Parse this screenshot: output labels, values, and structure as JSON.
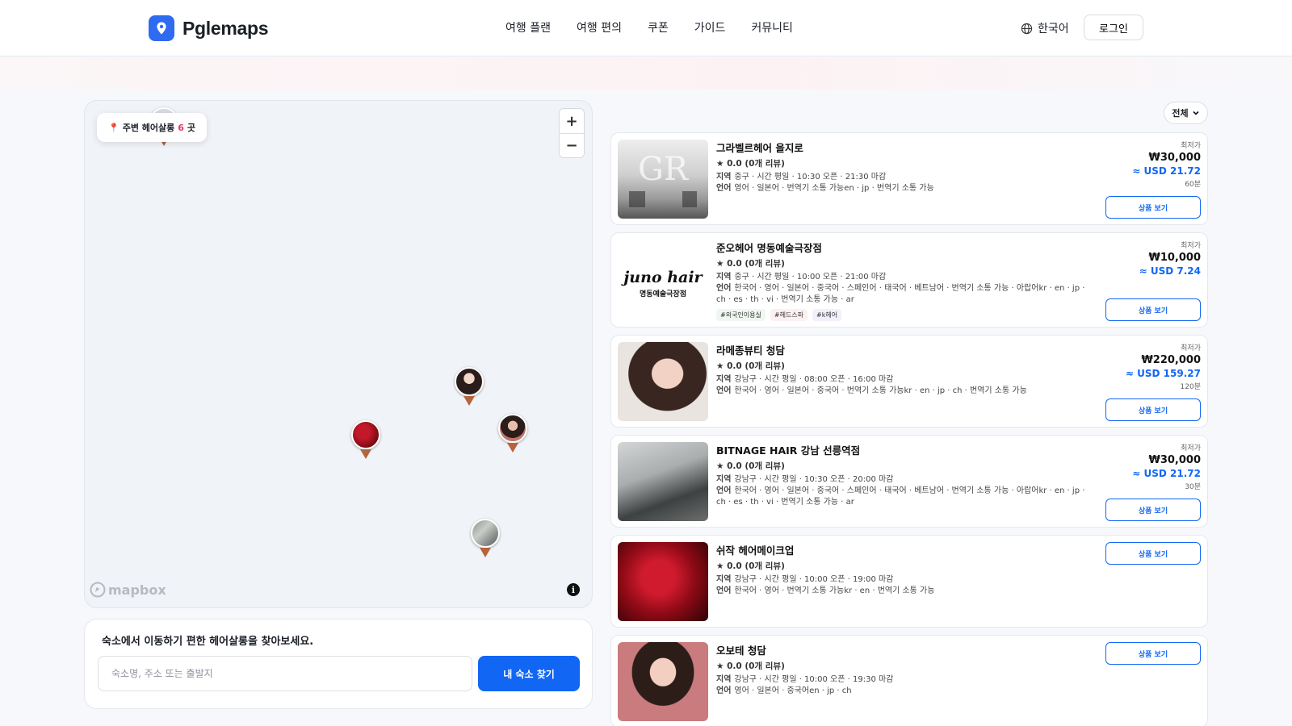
{
  "header": {
    "brand": "Pglemaps",
    "nav": [
      "여행 플랜",
      "여행 편의",
      "쿠폰",
      "가이드",
      "커뮤니티"
    ],
    "language": "한국어",
    "login": "로그인"
  },
  "map": {
    "badge_prefix": "주변 헤어살롱",
    "badge_count": "6",
    "badge_suffix": "곳",
    "zoom_in": "+",
    "zoom_out": "−",
    "attribution": "mapbox",
    "info": "i"
  },
  "search": {
    "title": "숙소에서 이동하기 편한 헤어살롱을 찾아보세요.",
    "placeholder": "숙소명, 주소 또는 출발지",
    "button": "내 숙소 찾기"
  },
  "filter": {
    "label": "전체"
  },
  "labels": {
    "region": "지역",
    "language": "언어",
    "lowest": "최저가",
    "view": "상품 보기"
  },
  "salons": [
    {
      "name": "그라벨르헤어 을지로",
      "rating": "★ 0.0 (0개 리뷰)",
      "region": "중구 · 시간  평일 · 10:30 오픈 · 21:30 마감",
      "languages": "영어 · 일본어 · 번역기 소통 가능en · jp · 번역기 소통 가능",
      "tags": [],
      "price_label": "최저가",
      "krw": "₩30,000",
      "usd": "≈ USD 21.72",
      "duration": "60분"
    },
    {
      "name": "준오헤어 명동예술극장점",
      "rating": "★ 0.0 (0개 리뷰)",
      "region": "중구 · 시간  평일 · 10:00 오픈 · 21:00 마감",
      "languages": "한국어 · 영어 · 일본어 · 중국어 · 스페인어 · 태국어 · 베트남어 · 번역기 소통 가능 · 아랍어kr · en · jp · ch · es · th · vi · 번역기 소통 가능 · ar",
      "tags": [
        "#외국인이용실",
        "#헤드스파",
        "#k헤어"
      ],
      "price_label": "최저가",
      "krw": "₩10,000",
      "usd": "≈ USD 7.24",
      "duration": ""
    },
    {
      "name": "라메종뷰티 청담",
      "rating": "★ 0.0 (0개 리뷰)",
      "region": "강남구 · 시간  평일 · 08:00 오픈 · 16:00 마감",
      "languages": "한국어 · 영어 · 일본어 · 중국어 · 번역기 소통 가능kr · en · jp · ch · 번역기 소통 가능",
      "tags": [],
      "price_label": "최저가",
      "krw": "₩220,000",
      "usd": "≈ USD 159.27",
      "duration": "120분"
    },
    {
      "name": "BITNAGE HAIR 강남 선릉역점",
      "rating": "★ 0.0 (0개 리뷰)",
      "region": "강남구 · 시간  평일 · 10:30 오픈 · 20:00 마감",
      "languages": "한국어 · 영어 · 일본어 · 중국어 · 스페인어 · 태국어 · 베트남어 · 번역기 소통 가능 · 아랍어kr · en · jp · ch · es · th · vi · 번역기 소통 가능 · ar",
      "tags": [],
      "price_label": "최저가",
      "krw": "₩30,000",
      "usd": "≈ USD 21.72",
      "duration": "30분"
    },
    {
      "name": "쉬작 헤어메이크업",
      "rating": "★ 0.0 (0개 리뷰)",
      "region": "강남구 · 시간  평일 · 10:00 오픈 · 19:00 마감",
      "languages": "한국어 · 영어 · 번역기 소통 가능kr · en · 번역기 소통 가능",
      "tags": [],
      "price_label": "",
      "krw": "",
      "usd": "",
      "duration": ""
    },
    {
      "name": "오보테 청담",
      "rating": "★ 0.0 (0개 리뷰)",
      "region": "강남구 · 시간  평일 · 10:00 오픈 · 19:30 마감",
      "languages": "영어 · 일본어 · 중국어en · jp · ch",
      "tags": [],
      "price_label": "",
      "krw": "",
      "usd": "",
      "duration": ""
    }
  ]
}
